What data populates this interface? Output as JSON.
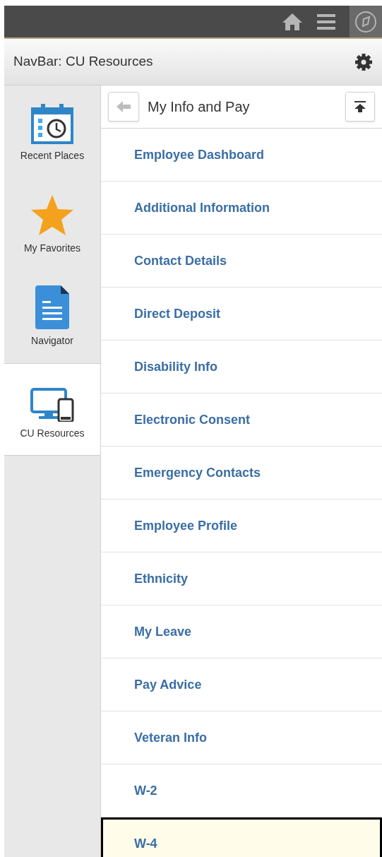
{
  "navbar": {
    "title": "NavBar: CU Resources"
  },
  "sidebar": {
    "items": [
      {
        "label": "Recent Places",
        "kind": "recent",
        "selected": false
      },
      {
        "label": "My Favorites",
        "kind": "favorites",
        "selected": false
      },
      {
        "label": "Navigator",
        "kind": "navigator",
        "selected": false
      },
      {
        "label": "CU Resources",
        "kind": "devices",
        "selected": true
      }
    ]
  },
  "panel": {
    "title": "My Info and Pay",
    "items": [
      {
        "label": "Employee Dashboard",
        "selected": false
      },
      {
        "label": "Additional Information",
        "selected": false
      },
      {
        "label": "Contact Details",
        "selected": false
      },
      {
        "label": "Direct Deposit",
        "selected": false
      },
      {
        "label": "Disability Info",
        "selected": false
      },
      {
        "label": "Electronic Consent",
        "selected": false
      },
      {
        "label": "Emergency Contacts",
        "selected": false
      },
      {
        "label": "Employee Profile",
        "selected": false
      },
      {
        "label": "Ethnicity",
        "selected": false
      },
      {
        "label": "My Leave",
        "selected": false
      },
      {
        "label": "Pay Advice",
        "selected": false
      },
      {
        "label": "Veteran Info",
        "selected": false
      },
      {
        "label": "W-2",
        "selected": false
      },
      {
        "label": "W-4",
        "selected": true
      }
    ]
  }
}
